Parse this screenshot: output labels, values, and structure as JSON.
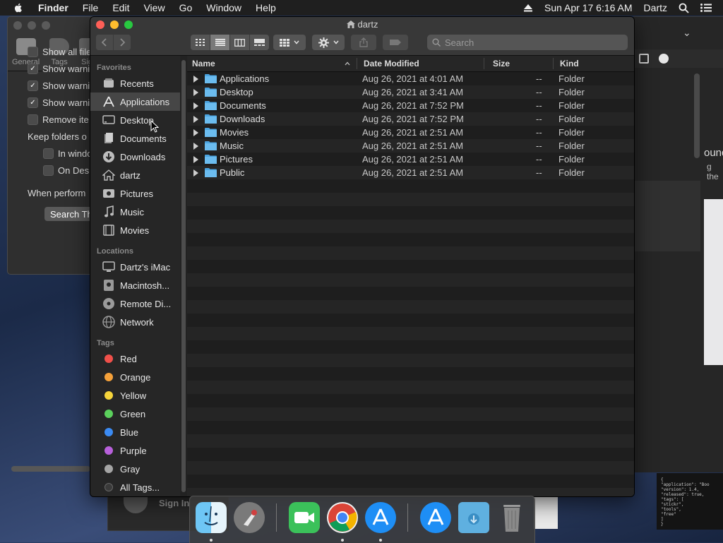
{
  "menubar": {
    "app_name": "Finder",
    "menus": [
      "File",
      "Edit",
      "View",
      "Go",
      "Window",
      "Help"
    ],
    "datetime": "Sun Apr 17  6:16 AM",
    "user": "Dartz"
  },
  "prefs_window": {
    "tabs": [
      "General",
      "Tags",
      "Side"
    ],
    "options": [
      {
        "label": "Show all file",
        "checked": false
      },
      {
        "label": "Show warni",
        "checked": true
      },
      {
        "label": "Show warni",
        "checked": true
      },
      {
        "label": "Show warni",
        "checked": true
      },
      {
        "label": "Remove ite",
        "checked": false
      }
    ],
    "keep_folders_label": "Keep folders o",
    "sub_options": [
      {
        "label": "In windo",
        "checked": false
      },
      {
        "label": "On Desk",
        "checked": false
      }
    ],
    "when_performing_label": "When perform",
    "search_button": "Search Th"
  },
  "finder": {
    "title": "dartz",
    "search_placeholder": "Search",
    "sidebar": {
      "favorites_header": "Favorites",
      "favorites": [
        {
          "label": "Recents",
          "icon": "clock-icon"
        },
        {
          "label": "Applications",
          "icon": "applications-icon",
          "selected": true
        },
        {
          "label": "Desktop",
          "icon": "desktop-icon"
        },
        {
          "label": "Documents",
          "icon": "documents-icon"
        },
        {
          "label": "Downloads",
          "icon": "downloads-icon"
        },
        {
          "label": "dartz",
          "icon": "home-icon"
        },
        {
          "label": "Pictures",
          "icon": "pictures-icon"
        },
        {
          "label": "Music",
          "icon": "music-icon"
        },
        {
          "label": "Movies",
          "icon": "movies-icon"
        }
      ],
      "locations_header": "Locations",
      "locations": [
        {
          "label": "Dartz's iMac",
          "icon": "imac-icon"
        },
        {
          "label": "Macintosh...",
          "icon": "disk-icon"
        },
        {
          "label": "Remote Di...",
          "icon": "remote-disc-icon"
        },
        {
          "label": "Network",
          "icon": "network-icon"
        }
      ],
      "tags_header": "Tags",
      "tags": [
        {
          "label": "Red",
          "color": "#f0504a"
        },
        {
          "label": "Orange",
          "color": "#f5a13a"
        },
        {
          "label": "Yellow",
          "color": "#f6d43b"
        },
        {
          "label": "Green",
          "color": "#5bd05c"
        },
        {
          "label": "Blue",
          "color": "#3b8bf3"
        },
        {
          "label": "Purple",
          "color": "#b860db"
        },
        {
          "label": "Gray",
          "color": "#a5a5a5"
        },
        {
          "label": "All Tags...",
          "color": "#3a3a3a"
        }
      ]
    },
    "columns": {
      "name": "Name",
      "date": "Date Modified",
      "size": "Size",
      "kind": "Kind"
    },
    "files": [
      {
        "name": "Applications",
        "date": "Aug 26, 2021 at 4:01 AM",
        "size": "--",
        "kind": "Folder"
      },
      {
        "name": "Desktop",
        "date": "Aug 26, 2021 at 3:41 AM",
        "size": "--",
        "kind": "Folder"
      },
      {
        "name": "Documents",
        "date": "Aug 26, 2021 at 7:52 PM",
        "size": "--",
        "kind": "Folder"
      },
      {
        "name": "Downloads",
        "date": "Aug 26, 2021 at 7:52 PM",
        "size": "--",
        "kind": "Folder"
      },
      {
        "name": "Movies",
        "date": "Aug 26, 2021 at 2:51 AM",
        "size": "--",
        "kind": "Folder"
      },
      {
        "name": "Music",
        "date": "Aug 26, 2021 at 2:51 AM",
        "size": "--",
        "kind": "Folder"
      },
      {
        "name": "Pictures",
        "date": "Aug 26, 2021 at 2:51 AM",
        "size": "--",
        "kind": "Folder"
      },
      {
        "name": "Public",
        "date": "Aug 26, 2021 at 2:51 AM",
        "size": "--",
        "kind": "Folder"
      }
    ]
  },
  "background": {
    "right_text_1": "ound",
    "right_text_2": "g the",
    "signin_label": "Sign In",
    "code_lines": [
      "{",
      "\"application\": \"Boo",
      "\"version\": 1.4,",
      "\"released\": true,",
      "\"tags\": [",
      "  \"stickr\",",
      "  \"tools\",",
      "  \"free\"",
      "]",
      "}"
    ]
  },
  "dock": {
    "apps": [
      "finder-icon",
      "launchpad-icon",
      "facetime-icon",
      "chrome-icon",
      "app-store-icon",
      "app-store-icon",
      "downloads-folder-icon",
      "trash-icon"
    ]
  },
  "colors": {
    "close": "#fe5f57",
    "minimize": "#febc2e",
    "zoom": "#28c840",
    "folder_blue": "#4aa3df"
  }
}
